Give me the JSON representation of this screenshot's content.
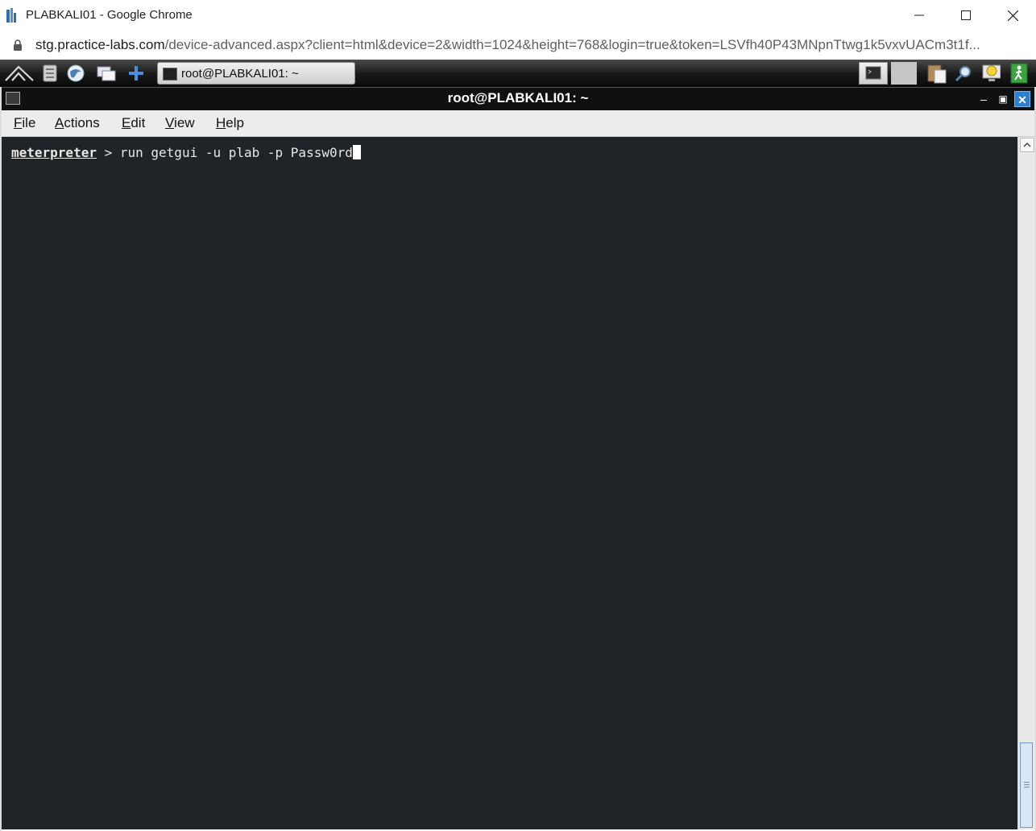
{
  "browser": {
    "window_title": "PLABKALI01 - Google Chrome",
    "url_host": "stg.practice-labs.com",
    "url_rest": "/device-advanced.aspx?client=html&device=2&width=1024&height=768&login=true&token=LSVfh40P43MNpnTtwg1k5vxvUACm3t1f..."
  },
  "taskbar": {
    "task_label": "root@PLABKALI01: ~",
    "icons": [
      "kali-menu-icon",
      "file-manager-icon",
      "browser-icon",
      "show-desktop-icon",
      "add-icon"
    ],
    "tray_icons": [
      "terminal-tray-icon",
      "clipboard-icon",
      "search-icon",
      "update-icon",
      "logout-icon"
    ]
  },
  "terminal_window": {
    "title": "root@PLABKALI01: ~",
    "menu": [
      {
        "mnemonic": "F",
        "rest": "ile"
      },
      {
        "mnemonic": "A",
        "rest": "ctions"
      },
      {
        "mnemonic": "E",
        "rest": "dit"
      },
      {
        "mnemonic": "V",
        "rest": "iew"
      },
      {
        "mnemonic": "H",
        "rest": "elp"
      }
    ],
    "prompt_name": "meterpreter",
    "prompt_symbol": " > ",
    "command": "run getgui -u plab -p Passw0rd"
  }
}
